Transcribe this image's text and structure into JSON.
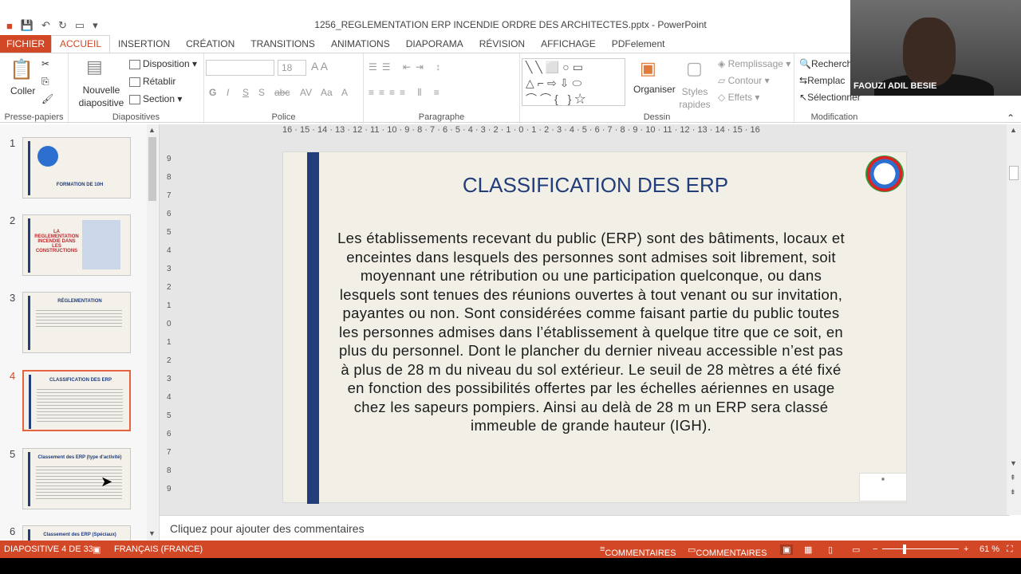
{
  "window": {
    "title": "1256_REGLEMENTATION ERP INCENDIE ORDRE DES ARCHITECTES.pptx - PowerPoint"
  },
  "tabs": [
    "FICHIER",
    "ACCUEIL",
    "INSERTION",
    "CRÉATION",
    "TRANSITIONS",
    "ANIMATIONS",
    "DIAPORAMA",
    "RÉVISION",
    "AFFICHAGE",
    "PDFelement"
  ],
  "ribbon": {
    "clipboard": {
      "paste": "Coller",
      "label": "Presse-papiers"
    },
    "slides": {
      "new_slide": "Nouvelle diapositive",
      "layout": "Disposition",
      "reset": "Rétablir",
      "section": "Section",
      "label": "Diapositives"
    },
    "font": {
      "size": "18",
      "label": "Police",
      "bold": "G",
      "italic": "I",
      "underline": "S",
      "shadow": "S",
      "strike": "abc"
    },
    "paragraph": {
      "label": "Paragraphe"
    },
    "drawing": {
      "arrange": "Organiser",
      "quick_styles": "Styles rapides",
      "fill": "Remplissage",
      "outline": "Contour",
      "effects": "Effets",
      "label": "Dessin"
    },
    "editing": {
      "find": "Recherch",
      "replace": "Remplac",
      "select": "Sélectionner",
      "label": "Modification"
    }
  },
  "webcam": {
    "name": "FAOUZI ADIL BESIE"
  },
  "thumbnails": [
    {
      "num": "1",
      "title": "FORMATION DE 10H"
    },
    {
      "num": "2",
      "title": "LA REGLEMENTATION INCENDIE DANS LES CONSTRUCTIONS"
    },
    {
      "num": "3",
      "title": "RÉGLEMENTATION"
    },
    {
      "num": "4",
      "title": "CLASSIFICATION DES ERP"
    },
    {
      "num": "5",
      "title": "Classement des ERP (type d'activité)"
    },
    {
      "num": "6",
      "title": "Classement des ERP (Spéciaux)"
    }
  ],
  "ruler": {
    "h": "16 · 15 · 14 · 13 · 12 · 11 · 10 · 9 · 8 · 7 · 6 · 5 · 4 · 3 · 2 · 1 · 0 · 1 · 2 · 3 · 4 · 5 · 6 · 7 · 8 · 9 · 10 · 11 · 12 · 13 · 14 · 15 · 16",
    "v": [
      "9",
      "8",
      "7",
      "6",
      "5",
      "4",
      "3",
      "2",
      "1",
      "0",
      "1",
      "2",
      "3",
      "4",
      "5",
      "6",
      "7",
      "8",
      "9"
    ]
  },
  "slide": {
    "title": "CLASSIFICATION DES ERP",
    "body": "Les établissements recevant du public (ERP) sont des bâtiments, locaux et enceintes dans lesquels des personnes sont admises soit librement, soit moyennant une rétribution ou une participation quelconque, ou dans lesquels sont tenues des réunions ouvertes à tout venant ou sur invitation, payantes ou non. Sont considérées comme faisant partie du public toutes les personnes admises dans l’établissement à quelque titre que ce soit, en plus du personnel. Dont le plancher du dernier niveau accessible n’est pas à plus de 28 m du niveau du sol extérieur. Le seuil de 28 mètres a été fixé en fonction des possibilités offertes par les échelles aériennes en usage chez les sapeurs pompiers. Ainsi au delà de 28 m un ERP sera classé immeuble de grande hauteur (IGH)."
  },
  "comments_placeholder": "Cliquez pour ajouter des commentaires",
  "status": {
    "slide_info": "DIAPOSITIVE 4 DE 33",
    "language": "FRANÇAIS (FRANCE)",
    "notes": "COMMENTAIRES",
    "comments": "COMMENTAIRES",
    "zoom": "61 %"
  },
  "colors": {
    "accent": "#d24726",
    "slide_navy": "#213d7a"
  }
}
